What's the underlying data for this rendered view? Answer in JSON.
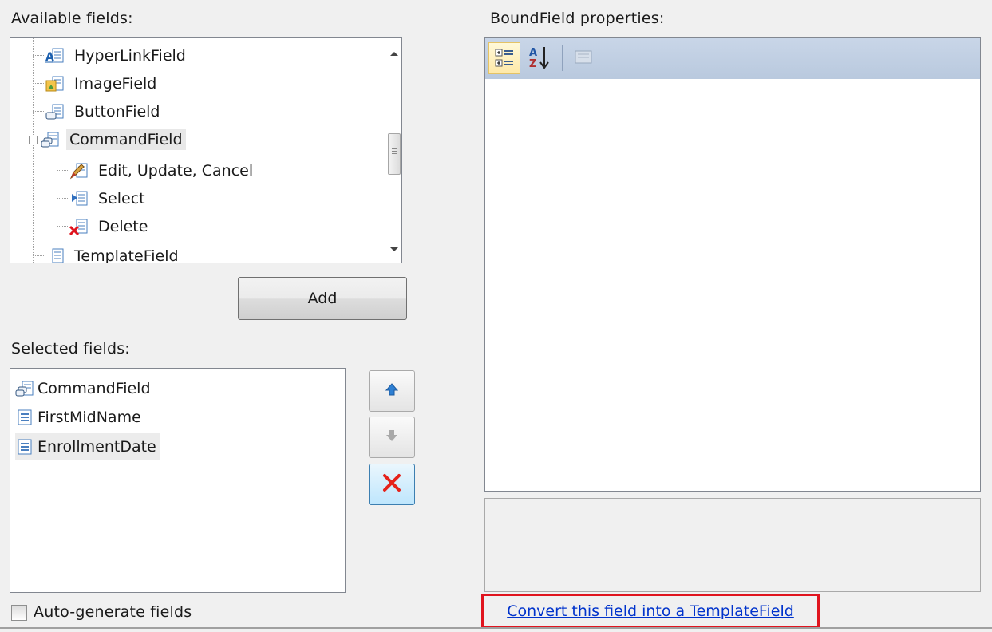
{
  "available_fields": {
    "label": "Available fields:",
    "items": [
      {
        "label": "HyperLinkField",
        "icon": "hyperlink-field-icon"
      },
      {
        "label": "ImageField",
        "icon": "image-field-icon"
      },
      {
        "label": "ButtonField",
        "icon": "button-field-icon"
      },
      {
        "label": "CommandField",
        "icon": "command-field-icon",
        "expanded": true,
        "selected": true
      },
      {
        "label": "Edit, Update, Cancel",
        "icon": "edit-command-icon"
      },
      {
        "label": "Select",
        "icon": "select-command-icon"
      },
      {
        "label": "Delete",
        "icon": "delete-command-icon"
      },
      {
        "label": "TemplateField",
        "icon": "template-field-icon"
      }
    ]
  },
  "add_button": {
    "label": "Add"
  },
  "selected_fields": {
    "label": "Selected fields:",
    "items": [
      {
        "label": "CommandField",
        "icon": "command-field-icon"
      },
      {
        "label": "FirstMidName",
        "icon": "bound-field-icon"
      },
      {
        "label": "EnrollmentDate",
        "icon": "bound-field-icon",
        "selected": true
      }
    ]
  },
  "move_buttons": {
    "up": {
      "icon": "arrow-up-icon",
      "enabled": true
    },
    "down": {
      "icon": "arrow-down-icon",
      "enabled": false
    },
    "delete": {
      "icon": "delete-x-icon",
      "enabled": true
    }
  },
  "auto_generate": {
    "label": "Auto-generate fields",
    "checked": false
  },
  "properties": {
    "label": "BoundField properties:",
    "toolbar": [
      "categorized-icon",
      "alphabetical-icon",
      "property-pages-icon"
    ]
  },
  "convert_link": {
    "label": "Convert this field into a TemplateField"
  },
  "colors": {
    "link": "#0033cc",
    "highlight_border": "#e0141e",
    "toolbar": "#c9d6e8"
  }
}
